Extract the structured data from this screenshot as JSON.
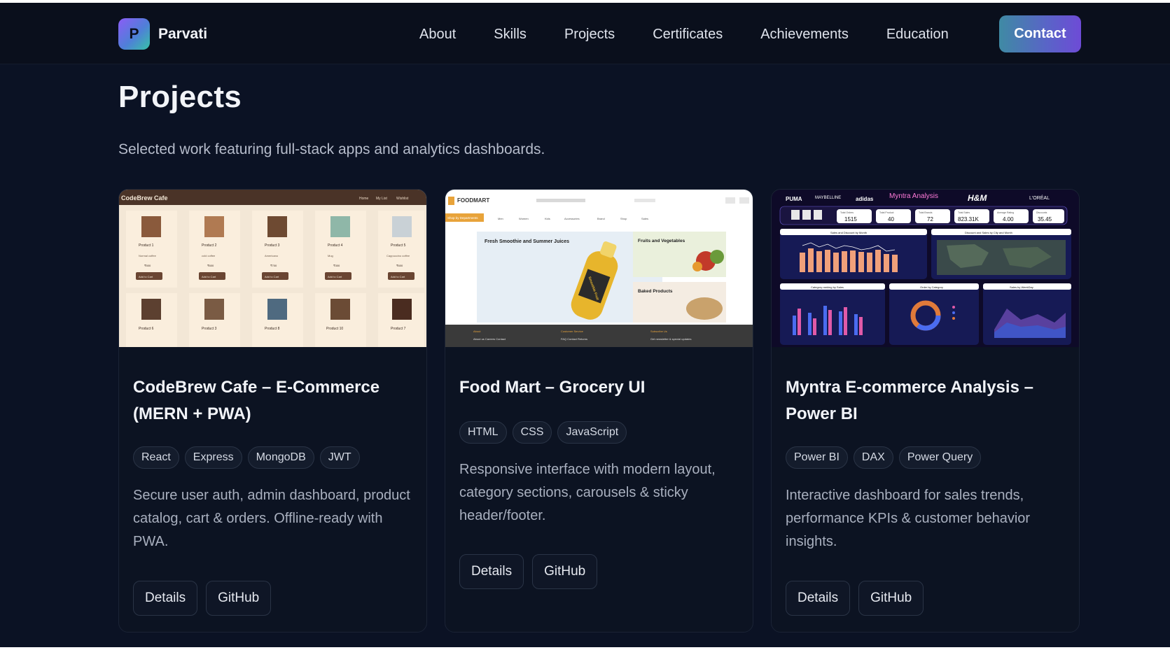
{
  "brand": {
    "logo_letter": "P",
    "name": "Parvati"
  },
  "nav": [
    "About",
    "Skills",
    "Projects",
    "Certificates",
    "Achievements",
    "Education"
  ],
  "contact_label": "Contact",
  "page": {
    "title": "Projects",
    "subtitle": "Selected work featuring full-stack apps and analytics dashboards."
  },
  "projects": [
    {
      "title": "CodeBrew Cafe – E-Commerce (MERN + PWA)",
      "tags": [
        "React",
        "Express",
        "MongoDB",
        "JWT"
      ],
      "description": "Secure user auth, admin dashboard, product catalog, cart & orders. Offline-ready with PWA.",
      "buttons": [
        "Details",
        "GitHub"
      ],
      "thumb": {
        "site_name": "CodeBrew Cafe",
        "nav": [
          "Home",
          "My List",
          "Wishlist"
        ],
        "products": [
          "Product 1",
          "Product 2",
          "Product 3",
          "Product 4",
          "Product 5",
          "Product 6",
          "Product 3",
          "Product 8",
          "Product 10",
          "Product 7"
        ],
        "subtexts": [
          "Normal coffee",
          "cold coffee",
          "Americano",
          "Mug",
          "Cappuccino coffee"
        ],
        "prices": [
          "₹500",
          "₹600",
          "₹700",
          "₹300",
          "₹600"
        ],
        "cart_label": "Add to Cart"
      }
    },
    {
      "title": "Food Mart – Grocery UI",
      "tags": [
        "HTML",
        "CSS",
        "JavaScript"
      ],
      "description": "Responsive interface with modern layout, category sections, carousels & sticky header/footer.",
      "buttons": [
        "Details",
        "GitHub"
      ],
      "thumb": {
        "logo": "FOODMART",
        "category_label": "Shop by Departments",
        "menu": [
          "Men",
          "Women",
          "Kids",
          "Accessories",
          "Brand",
          "Shop",
          "Sales"
        ],
        "hero": "Fresh Smoothie and Summer Juices",
        "bottle_label": "Smoothie Fruit",
        "side1": "Fruits and Vegetables",
        "side2": "Baked Products",
        "footer_heads": [
          "About",
          "Customer Service",
          "Subscribe Us"
        ],
        "footer_items": [
          "About us  Careers  Contact",
          "FAQ  Contact  Returns",
          "Get newsletter & special updates"
        ]
      }
    },
    {
      "title": "Myntra E-commerce Analysis – Power BI",
      "tags": [
        "Power BI",
        "DAX",
        "Power Query"
      ],
      "description": "Interactive dashboard for sales trends, performance KPIs & customer behavior insights.",
      "buttons": [
        "Details",
        "GitHub"
      ],
      "thumb": {
        "brands": [
          "PUMA",
          "MAYBELLINE",
          "adidas",
          "H&M",
          "L'ORÉAL"
        ],
        "title": "Myntra Analysis",
        "kpis": [
          {
            "label": "Total Orders",
            "value": "1515"
          },
          {
            "label": "Total Product",
            "value": "40"
          },
          {
            "label": "Total Brands",
            "value": "72"
          },
          {
            "label": "Total Sales",
            "value": "823.31K"
          },
          {
            "label": "Average Rating",
            "value": "4.00"
          },
          {
            "label": "Discounts",
            "value": "35.45"
          }
        ],
        "panels": [
          "Sales and Discount by Month",
          "Discount and Sales by City and Month",
          "Category ranking by Sales",
          "Order by Category",
          "Sales by WeekDay"
        ]
      }
    }
  ],
  "colors": {
    "background": "#0b1224",
    "header": "#0a0f1c",
    "card": "#0c1322",
    "accent_start": "#3f8aa4",
    "accent_end": "#6e4bd6"
  }
}
